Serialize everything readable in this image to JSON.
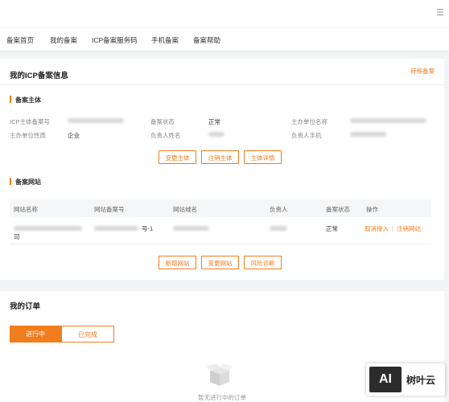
{
  "topbar": {
    "menu_icon": "menu-icon"
  },
  "nav": [
    "备案首页",
    "我的备案",
    "ICP备案服务码",
    "手机备案",
    "备案帮助"
  ],
  "icp": {
    "title": "我的ICP备案信息",
    "transfer": "转移备案",
    "subject": {
      "heading": "备案主体",
      "labels": {
        "icp_subject_no": "ICP主体备案号",
        "status": "备案状态",
        "org_name": "主办单位名称",
        "org_nature": "主办单位性质",
        "owner_name": "负责人姓名",
        "owner_phone": "负责人手机"
      },
      "values": {
        "status": "正常",
        "org_nature": "企业"
      },
      "buttons": {
        "change": "变更主体",
        "cancel": "注销主体",
        "detail": "主体详情"
      }
    },
    "site": {
      "heading": "备案网站",
      "columns": [
        "网站名称",
        "网站备案号",
        "网站域名",
        "负责人",
        "备案状态",
        "操作"
      ],
      "row": {
        "name_tail": "司",
        "record_no_tail": "号-1",
        "status": "正常",
        "op_cancel_access": "取消接入",
        "op_cancel_site": "注销网站"
      },
      "buttons": {
        "add": "新增网站",
        "change": "变更网站",
        "diagnose": "风险诊断"
      }
    }
  },
  "orders": {
    "title": "我的订单",
    "tabs": {
      "active": "进行中",
      "done": "已完成"
    },
    "empty_text": "暂无进行中的订单"
  },
  "brand": {
    "logo_text": "AI",
    "name": "树叶云"
  },
  "colors": {
    "accent": "#f07d1e",
    "background": "#f3f4f6"
  }
}
